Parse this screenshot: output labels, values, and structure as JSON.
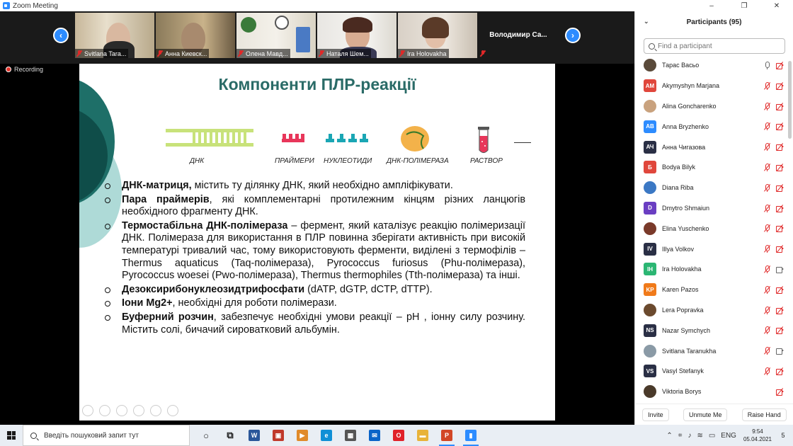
{
  "window": {
    "title": "Zoom Meeting",
    "controls": [
      "–",
      "❐",
      "✕"
    ]
  },
  "gallery": {
    "prev_label": "‹",
    "next_label": "›",
    "tiles": [
      {
        "name": "Svitlana Tara...",
        "muted": true
      },
      {
        "name": "Анна Киевск...",
        "muted": true
      },
      {
        "name": "Олена Мавд...",
        "muted": true
      },
      {
        "name": "Наталя Шем...",
        "muted": true
      },
      {
        "name": "Ira Holovakha",
        "muted": true
      },
      {
        "name": "Володимир  Са...",
        "muted": true
      }
    ]
  },
  "recording": {
    "label": "Recording"
  },
  "slide": {
    "title": "Компоненти ПЛР-реакції",
    "components": [
      "ДНК",
      "ПРАЙМЕРИ",
      "НУКЛЕОТИДИ",
      "ДНК-ПОЛІМЕРАЗА",
      "РАСТВОР"
    ],
    "bullets": [
      {
        "bold": "ДНК-матриця,",
        "text": " містить ту ділянку ДНК, який необхідно ампліфікувати."
      },
      {
        "bold": "Пара праймерів",
        "text": ", які комплементарні протилежним кінцям різних ланцюгів необхідного фрагменту ДНК."
      },
      {
        "bold": "Термостабільна ДНК-полімераза",
        "text": " – фермент, який каталізує реакцію полімеризації ДНК. Полімераза для використання в ПЛР повинна зберігати активність при високій температурі тривалий час, тому використовують ферменти, виділені з термофілів – Thermus aquaticus (Taq-полімераза), Pyrococcus furiosus (Phu-полімераза), Pyrococcus woesei (Pwo-полімераза), Thermus thermophiles (Tth-полімераза) та інші."
      },
      {
        "bold": "Дезоксирибонуклеозидтрифосфати",
        "text": " (dATP, dGTP, dCTP, dTTP)."
      },
      {
        "bold": "Іони Mg2+",
        "text": ", необхідні для роботи полімерази."
      },
      {
        "bold": "Буферний розчин",
        "text": ", забезпечує необхідні умови реакції – рН , іонну силу розчину. Містить солі, бичачий сироватковий альбумін."
      }
    ]
  },
  "participants": {
    "title": "Participants (95)",
    "search_placeholder": "Find a participant",
    "list": [
      {
        "name": "Тарас Васьо",
        "initials": "",
        "color": "#5a4a3a",
        "mic": "on",
        "cam": "off"
      },
      {
        "name": "Akymyshyn Marjana",
        "initials": "AM",
        "color": "#e0473c",
        "mic": "off",
        "cam": "off"
      },
      {
        "name": "Alina Goncharenko",
        "initials": "",
        "color": "#c9a27e",
        "mic": "off",
        "cam": "off"
      },
      {
        "name": "Anna Bryzhenko",
        "initials": "AB",
        "color": "#2d8cff",
        "mic": "off",
        "cam": "off"
      },
      {
        "name": "Анна Чигазова",
        "initials": "АЧ",
        "color": "#2a2f45",
        "mic": "off",
        "cam": "off"
      },
      {
        "name": "Bodya Bilyk",
        "initials": "Б",
        "color": "#e0473c",
        "mic": "off",
        "cam": "off"
      },
      {
        "name": "Diana Riba",
        "initials": "",
        "color": "#3b78c4",
        "mic": "off",
        "cam": "off"
      },
      {
        "name": "Dmytro Shmaiun",
        "initials": "D",
        "color": "#6a3ec2",
        "mic": "off",
        "cam": "off"
      },
      {
        "name": "Elina Yuschenko",
        "initials": "",
        "color": "#7a3a2a",
        "mic": "off",
        "cam": "off"
      },
      {
        "name": "Illya Volkov",
        "initials": "IV",
        "color": "#2a2f45",
        "mic": "off",
        "cam": "off"
      },
      {
        "name": "Ira Holovakha",
        "initials": "IH",
        "color": "#2bb673",
        "mic": "off",
        "cam": "on"
      },
      {
        "name": "Karen Pazos",
        "initials": "KP",
        "color": "#f07a1a",
        "mic": "off",
        "cam": "off"
      },
      {
        "name": "Lera Popravka",
        "initials": "",
        "color": "#6b4a2e",
        "mic": "off",
        "cam": "off"
      },
      {
        "name": "Nazar Symchych",
        "initials": "NS",
        "color": "#2a2f45",
        "mic": "off",
        "cam": "off"
      },
      {
        "name": "Svitlana Taranukha",
        "initials": "",
        "color": "#8a9aa6",
        "mic": "off",
        "cam": "on"
      },
      {
        "name": "Vasyl Stefanyk",
        "initials": "VS",
        "color": "#2a2f45",
        "mic": "off",
        "cam": "off"
      },
      {
        "name": "Viktoria  Borys",
        "initials": "",
        "color": "#4a3a2a",
        "mic": "none",
        "cam": "off"
      }
    ],
    "buttons": {
      "invite": "Invite",
      "unmute": "Unmute Me",
      "raise": "Raise Hand"
    }
  },
  "taskbar": {
    "search_text": "Введіть пошуковий запит тут",
    "apps": [
      {
        "id": "cortana",
        "label": "○",
        "color": "#1a1a1a"
      },
      {
        "id": "taskview",
        "label": "⧉",
        "color": "#1a1a1a"
      },
      {
        "id": "word",
        "label": "W",
        "color": "#2b579a"
      },
      {
        "id": "store",
        "label": "▣",
        "color": "#c0392b"
      },
      {
        "id": "media",
        "label": "▶",
        "color": "#e08a2a"
      },
      {
        "id": "edge",
        "label": "e",
        "color": "#0f8fd6"
      },
      {
        "id": "calculator",
        "label": "▦",
        "color": "#555555"
      },
      {
        "id": "mail",
        "label": "✉",
        "color": "#0a64c8"
      },
      {
        "id": "opera",
        "label": "O",
        "color": "#e0222a"
      },
      {
        "id": "explorer",
        "label": "▬",
        "color": "#e8b33a"
      },
      {
        "id": "powerpoint",
        "label": "P",
        "color": "#d24726"
      },
      {
        "id": "zoom",
        "label": "▮",
        "color": "#2d8cff"
      }
    ],
    "lang": "ENG",
    "time": "9:54",
    "date": "05.04.2021",
    "notifications": "5"
  }
}
